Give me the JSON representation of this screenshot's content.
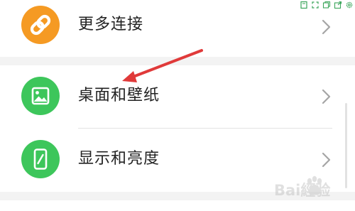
{
  "settings_rows": [
    {
      "label": "更多连接",
      "icon": "link-icon",
      "icon_color": "#f59a23"
    },
    {
      "label": "桌面和壁纸",
      "icon": "image-icon",
      "icon_color": "#3dc65b"
    },
    {
      "label": "显示和亮度",
      "icon": "phone-brightness-icon",
      "icon_color": "#3dc65b"
    }
  ],
  "annotation": {
    "arrow_color": "#e03a3a"
  },
  "watermark": {
    "text": "Bai經验",
    "logo": "baidu-paw-icon"
  },
  "colors": {
    "background": "#f3f3f3",
    "card": "#ffffff",
    "chevron": "#a5a5a5",
    "divider": "#e3e3e3"
  },
  "toolbar_icons": [
    "bookmark-icon",
    "fullscreen-icon",
    "copy-icon",
    "share-icon",
    "settings-icon"
  ]
}
